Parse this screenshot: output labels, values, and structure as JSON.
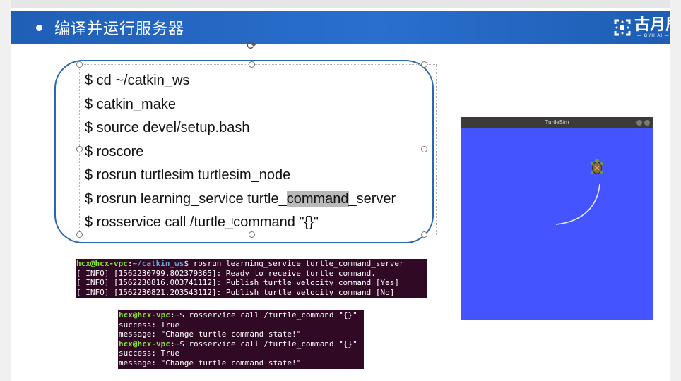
{
  "slide": {
    "title": "编译并运行服务器",
    "logo_cn": "古月居",
    "logo_en": "— GYH.AI —"
  },
  "commands": [
    "$ cd ~/catkin_ws",
    "$ catkin_make",
    "$ source devel/setup.bash",
    "$ roscore",
    "$ rosrun turtlesim turtlesim_node",
    {
      "before": "$ rosrun learning_service turtle_",
      "highlight": "command",
      "after": "_server"
    },
    "$ rosservice call /turtle_command \"{}\""
  ],
  "terminal1": {
    "prompt_user": "hcx@hcx-vpc",
    "prompt_path": "~/catkin_ws",
    "command": "$ rosrun learning_service turtle_command_server",
    "lines": [
      "[ INFO] [1562230799.802379365]: Ready to receive turtle command.",
      "[ INFO] [1562230816.003741112]: Publish turtle velocity command [Yes]",
      "[ INFO] [1562230821.203543112]: Publish turtle velocity command [No]"
    ]
  },
  "terminal2": {
    "prompt_user": "hcx@hcx-vpc",
    "prompt_path": "~",
    "command": "$ rosservice call /turtle_command \"{}\"",
    "line_success": "success: True",
    "line_message": "message: \"Change turtle command state!\""
  },
  "turtlesim": {
    "window_title": "TurtleSim",
    "background_color": "#4455ff",
    "path_color": "#e8e8ff"
  }
}
